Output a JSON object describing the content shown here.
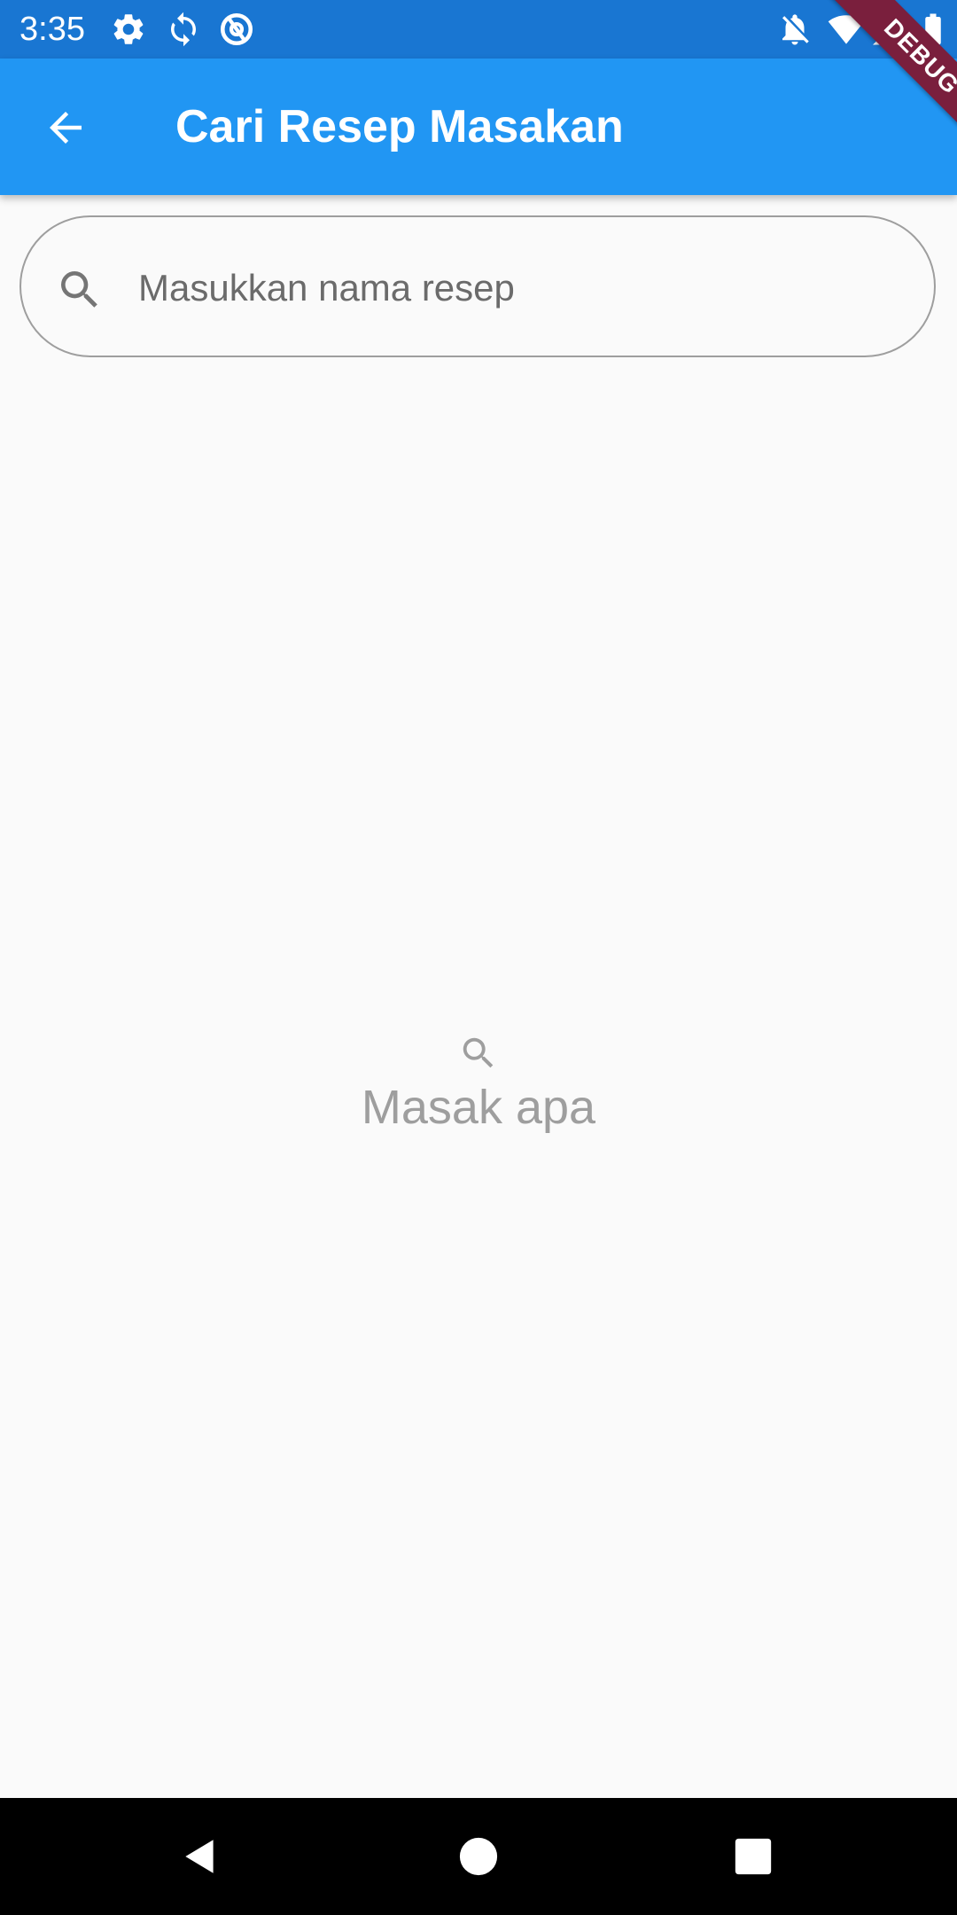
{
  "status_bar": {
    "time": "3:35",
    "left_icons": [
      "gear-icon",
      "sync-icon",
      "at-sign-icon"
    ],
    "right_icons": [
      "bell-off-icon",
      "wifi-icon",
      "cell-signal-icon",
      "battery-icon"
    ],
    "color": "#1976d2"
  },
  "app_bar": {
    "title": "Cari Resep Masakan",
    "back_icon": "arrow-left-icon",
    "color": "#2196f3"
  },
  "debug_banner": {
    "label": "DEBUG",
    "color": "#7a1f3d"
  },
  "search": {
    "placeholder": "Masukkan nama resep",
    "value": "",
    "icon": "search-icon"
  },
  "empty_state": {
    "icon": "search-icon",
    "text": "Masak apa"
  },
  "nav_bar": {
    "buttons": [
      "back-triangle-icon",
      "home-circle-icon",
      "recents-square-icon"
    ]
  }
}
